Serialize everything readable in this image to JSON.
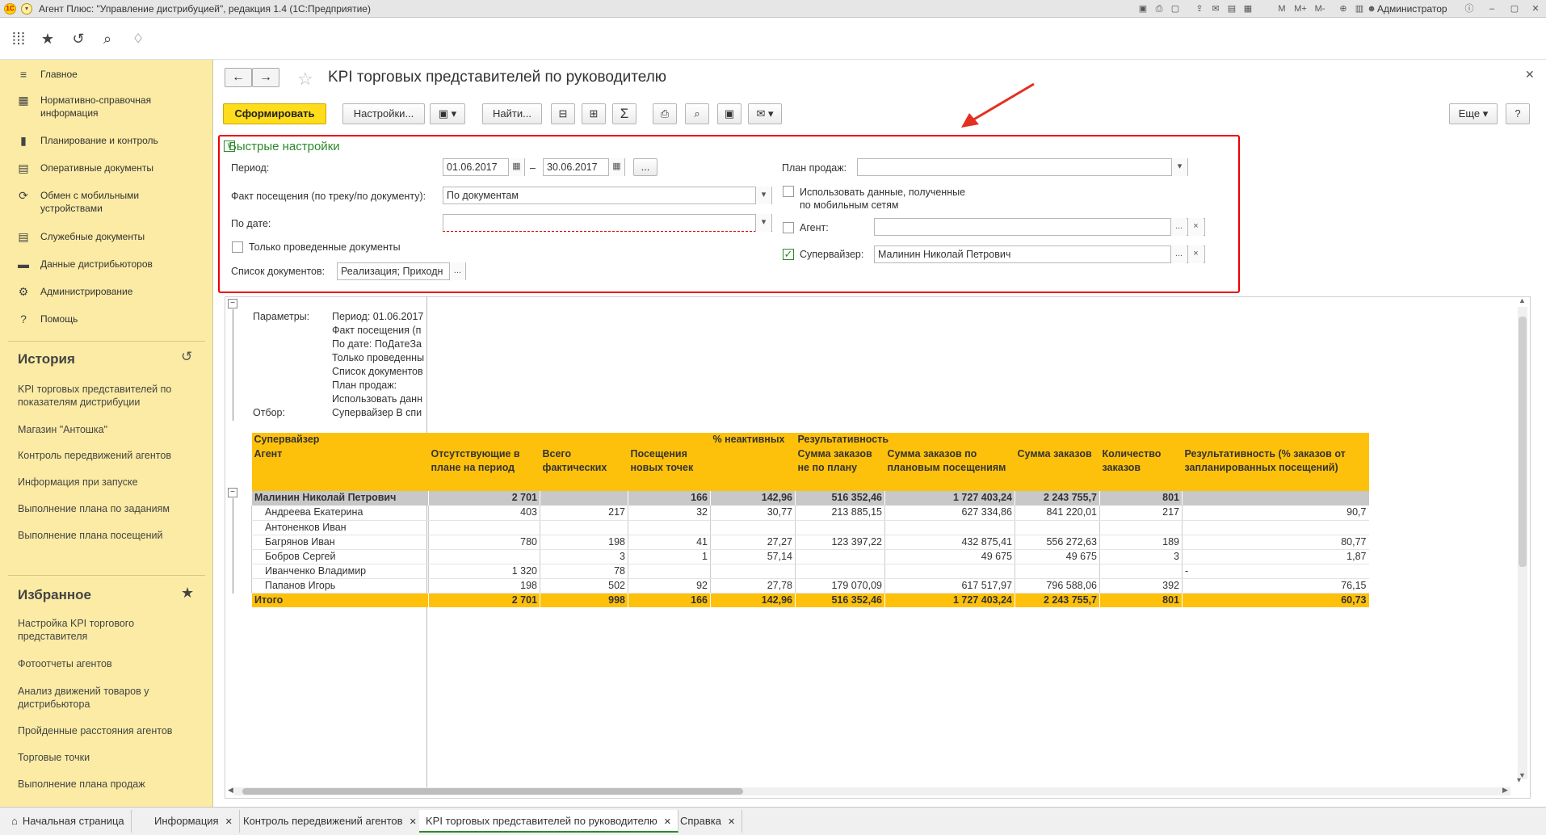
{
  "window": {
    "title": "Агент Плюс: \"Управление дистрибуцией\", редакция 1.4  (1С:Предприятие)",
    "user": "Администратор",
    "logo_text": "1C"
  },
  "sidebar": {
    "items": [
      {
        "label": "Главное",
        "icon": "menu-icon",
        "glyph": "≡"
      },
      {
        "label": "Нормативно-справочная информация",
        "icon": "grid-icon",
        "glyph": "▦"
      },
      {
        "label": "Планирование и контроль",
        "icon": "chart-icon",
        "glyph": "▮"
      },
      {
        "label": "Оперативные документы",
        "icon": "document-icon",
        "glyph": "▤"
      },
      {
        "label": "Обмен с мобильными устройствами",
        "icon": "sync-icon",
        "glyph": "⟳"
      },
      {
        "label": "Служебные документы",
        "icon": "docs-icon",
        "glyph": "▤"
      },
      {
        "label": "Данные дистрибьюторов",
        "icon": "truck-icon",
        "glyph": "▬"
      },
      {
        "label": "Администрирование",
        "icon": "gear-icon",
        "glyph": "⚙"
      },
      {
        "label": "Помощь",
        "icon": "question-icon",
        "glyph": "?"
      }
    ],
    "history_title": "История",
    "history": [
      "KPI торговых представителей по показателям дистрибуции",
      "Магазин \"Антошка\"",
      "Контроль передвижений агентов",
      "Информация при запуске",
      "Выполнение плана по заданиям",
      "Выполнение плана посещений"
    ],
    "favorites_title": "Избранное",
    "favorites": [
      "Настройка KPI торгового представителя",
      "Фотоотчеты агентов",
      "Анализ движений товаров у дистрибьютора",
      "Пройденные расстояния агентов",
      "Торговые точки",
      "Выполнение плана продаж"
    ]
  },
  "form": {
    "title": "KPI торговых представителей по руководителю",
    "toolbar": {
      "generate": "Сформировать",
      "settings": "Настройки...",
      "find": "Найти...",
      "more": "Еще",
      "help": "?",
      "sum": "Σ"
    },
    "quick": {
      "title": "Быстрые настройки",
      "period_label": "Период:",
      "period_from": "01.06.2017",
      "period_dash": "–",
      "period_to": "30.06.2017",
      "visit_label": "Факт посещения (по треку/по документу):",
      "visit_value": "По документам",
      "bydate_label": "По дате:",
      "bydate_value": "",
      "only_posted": "Только проведенные документы",
      "doclist_label": "Список документов:",
      "doclist_value": "Реализация; Приходн",
      "plan_label": "План продаж:",
      "plan_value": "",
      "mobile_data": "Использовать данные, полученные по мобильным сетям",
      "agent_label": "Агент:",
      "agent_value": "",
      "supervisor_label": "Супервайзер:",
      "supervisor_value": "Малинин Николай Петрович"
    }
  },
  "report": {
    "params_label": "Параметры:",
    "params": [
      "Период: 01.06.2017",
      "Факт посещения (п",
      "По дате: ПоДатеЗа",
      "Только проведенны",
      "Список документов",
      "План продаж:",
      "Использовать данн"
    ],
    "filter_label": "Отбор:",
    "filter_value": "Супервайзер В спи",
    "header": {
      "c0a": "Супервайзер",
      "c0b": "Агент",
      "c1": "Отсутствующие в плане на период",
      "c2": "Всего фактических",
      "c3": "Посещения новых точек",
      "c4": "% неактивных",
      "group": "Результативность",
      "c5": "Сумма заказов не по плану",
      "c6": "Сумма заказов по плановым посещениям",
      "c7": "Сумма заказов",
      "c8": "Количество заказов",
      "c9": "Результативность (% заказов от запланированных посещений)"
    },
    "group_row": [
      "Малинин Николай Петрович",
      "2 701",
      "",
      "166",
      "142,96",
      "516 352,46",
      "1 727 403,24",
      "2 243 755,7",
      "801",
      ""
    ],
    "rows": [
      [
        "Андреева Екатерина",
        "403",
        "217",
        "32",
        "30,77",
        "213 885,15",
        "627 334,86",
        "841 220,01",
        "217",
        "90,7"
      ],
      [
        "Антоненков Иван",
        "",
        "",
        "",
        "",
        "",
        "",
        "",
        "",
        ""
      ],
      [
        "Багрянов Иван",
        "780",
        "198",
        "41",
        "27,27",
        "123 397,22",
        "432 875,41",
        "556 272,63",
        "189",
        "80,77"
      ],
      [
        "Бобров Сергей",
        "",
        "3",
        "1",
        "57,14",
        "",
        "49 675",
        "49 675",
        "3",
        "1,87"
      ],
      [
        "Иванченко Владимир",
        "1 320",
        "78",
        "",
        "",
        "",
        "",
        "",
        "",
        "-"
      ],
      [
        "Папанов Игорь",
        "198",
        "502",
        "92",
        "27,78",
        "179 070,09",
        "617 517,97",
        "796 588,06",
        "392",
        "76,15"
      ]
    ],
    "total_row": [
      "Итого",
      "2 701",
      "998",
      "166",
      "142,96",
      "516 352,46",
      "1 727 403,24",
      "2 243 755,7",
      "801",
      "60,73"
    ]
  },
  "tabs": [
    {
      "label": "Начальная страница"
    },
    {
      "label": "Информация"
    },
    {
      "label": "Контроль передвижений агентов"
    },
    {
      "label": "KPI торговых представителей по руководителю"
    },
    {
      "label": "Справка"
    }
  ],
  "colors": {
    "sidebar": "#fbeba4",
    "accent_yellow": "#ffdc1c",
    "report_header": "#fec10b",
    "highlight": "#ee0000",
    "green": "#2a8a2a"
  }
}
